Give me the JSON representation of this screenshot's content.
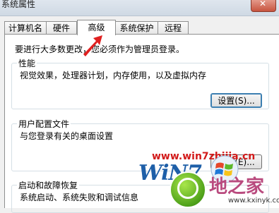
{
  "window": {
    "title": "系统属性"
  },
  "tabs": [
    "计算机名",
    "硬件",
    "高级",
    "系统保护",
    "远程"
  ],
  "notice": "要进行大多数更改，您必须作为管理员登录。",
  "performance": {
    "title": "性能",
    "description": "视觉效果，处理器计划，内存使用，以及虚拟内存",
    "button": "设置(S)..."
  },
  "user_profiles": {
    "title": "用户配置文件",
    "description": "与您登录有关的桌面设置",
    "button": "设置(E)..."
  },
  "startup_recovery": {
    "title": "启动和故障恢复",
    "description": "系统启动、系统失败和调试信息"
  },
  "watermark": {
    "url": "www.win7zhijia.cn",
    "logo": "WiN7",
    "brand": "地之家",
    "brand_url": "www.kxinyk.com"
  },
  "colors": {
    "arrow": "#e02020",
    "watermark_red": "#d21a1a"
  }
}
